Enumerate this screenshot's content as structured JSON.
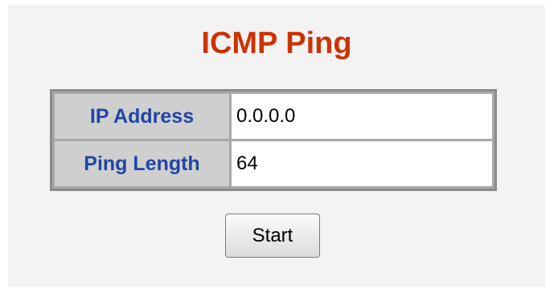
{
  "page": {
    "title": "ICMP Ping"
  },
  "form": {
    "fields": [
      {
        "label": "IP Address",
        "value": "0.0.0.0"
      },
      {
        "label": "Ping Length",
        "value": "64"
      }
    ],
    "start_label": "Start"
  },
  "colors": {
    "title": "#cc3300",
    "label_text": "#1f45a6",
    "label_bg": "#cfcfcf",
    "panel_bg": "#f3f3f3"
  }
}
